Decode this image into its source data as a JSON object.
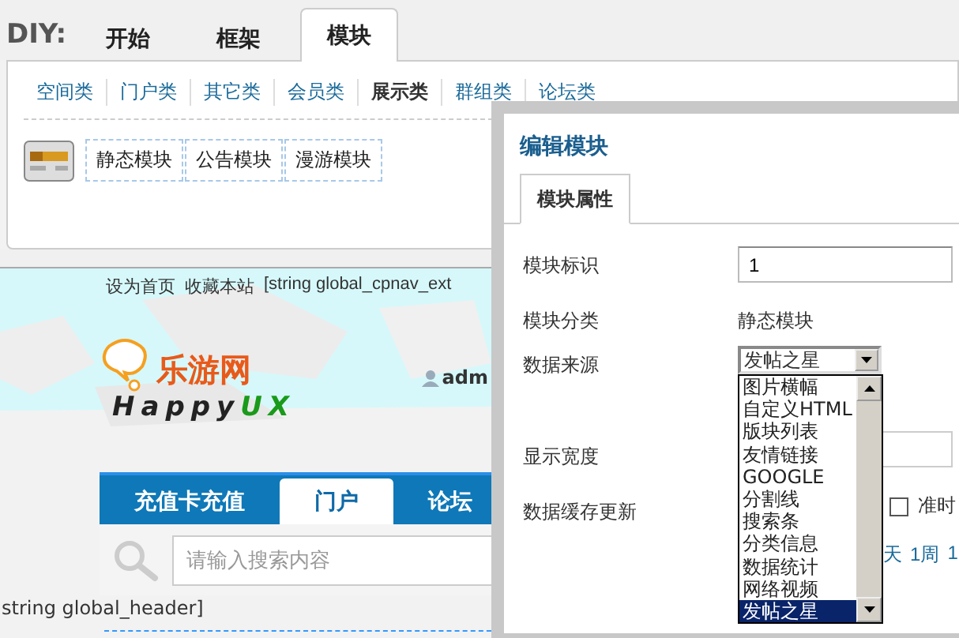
{
  "diy_bar": {
    "label": "DIY:",
    "tabs": [
      {
        "label": "开始",
        "selected": false
      },
      {
        "label": "框架",
        "selected": false
      },
      {
        "label": "模块",
        "selected": true
      }
    ]
  },
  "categories": [
    {
      "label": "空间类",
      "selected": false
    },
    {
      "label": "门户类",
      "selected": false
    },
    {
      "label": "其它类",
      "selected": false
    },
    {
      "label": "会员类",
      "selected": false
    },
    {
      "label": "展示类",
      "selected": true
    },
    {
      "label": "群组类",
      "selected": false
    },
    {
      "label": "论坛类",
      "selected": false
    }
  ],
  "modules": [
    "静态模块",
    "公告模块",
    "漫游模块"
  ],
  "site": {
    "top_links": [
      "设为首页",
      "收藏本站",
      "[string global_cpnav_ext"
    ],
    "logo": {
      "name": "乐游网",
      "word_a": "Happy",
      "word_b": "UX"
    },
    "user": "adm",
    "nav": [
      {
        "label": "充值卡充值",
        "selected": false
      },
      {
        "label": "门户",
        "selected": true
      },
      {
        "label": "论坛",
        "selected": false
      }
    ],
    "search": {
      "placeholder": "请输入搜索内容"
    },
    "header_text": "string global_header]"
  },
  "dialog": {
    "title": "编辑模块",
    "tabs": [
      {
        "label": "模块属性",
        "selected": true
      }
    ],
    "fields": [
      {
        "kind": "input",
        "label": "模块标识",
        "value": "1"
      },
      {
        "kind": "text",
        "label": "模块分类",
        "value": "静态模块"
      },
      {
        "kind": "select",
        "label": "数据来源",
        "value": "发帖之星",
        "options": [
          {
            "label": "图片横幅",
            "selected": false
          },
          {
            "label": "自定义HTML",
            "selected": false
          },
          {
            "label": "版块列表",
            "selected": false
          },
          {
            "label": "友情链接",
            "selected": false
          },
          {
            "label": "GOOGLE",
            "selected": false
          },
          {
            "label": "分割线",
            "selected": false
          },
          {
            "label": "搜索条",
            "selected": false
          },
          {
            "label": "分类信息",
            "selected": false
          },
          {
            "label": "数据统计",
            "selected": false
          },
          {
            "label": "网络视频",
            "selected": false
          },
          {
            "label": "发帖之星",
            "selected": true
          }
        ]
      },
      {
        "kind": "width",
        "label": "显示宽度"
      },
      {
        "kind": "cache",
        "label": "数据缓存更新",
        "checkbox": {
          "label": "准时",
          "checked": false
        },
        "links": [
          "天",
          "1周",
          "1"
        ]
      }
    ]
  }
}
